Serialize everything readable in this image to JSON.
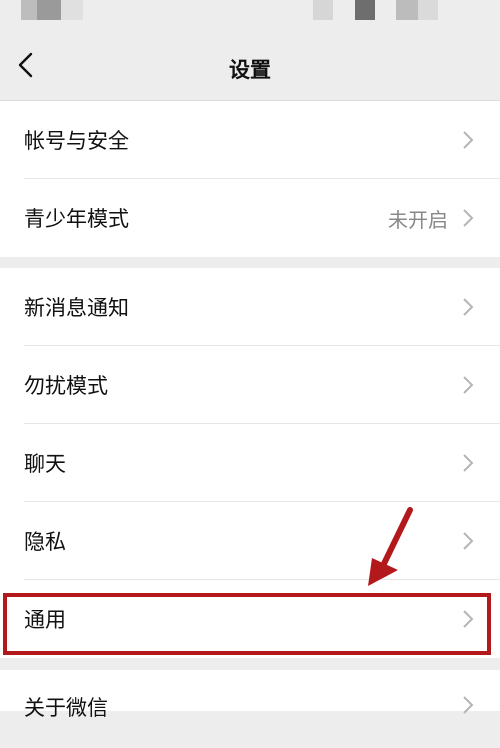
{
  "header": {
    "title": "设置",
    "back_icon": "chevron-left-icon"
  },
  "groups": [
    {
      "items": [
        {
          "label": "帐号与安全",
          "value": ""
        },
        {
          "label": "青少年模式",
          "value": "未开启"
        }
      ]
    },
    {
      "items": [
        {
          "label": "新消息通知",
          "value": ""
        },
        {
          "label": "勿扰模式",
          "value": ""
        },
        {
          "label": "聊天",
          "value": ""
        },
        {
          "label": "隐私",
          "value": ""
        },
        {
          "label": "通用",
          "value": "",
          "highlighted": true
        }
      ]
    },
    {
      "items": [
        {
          "label": "关于微信",
          "value": ""
        }
      ]
    }
  ],
  "annotation": {
    "highlight_color": "#b3191b",
    "arrow_icon": "red-arrow-icon"
  }
}
